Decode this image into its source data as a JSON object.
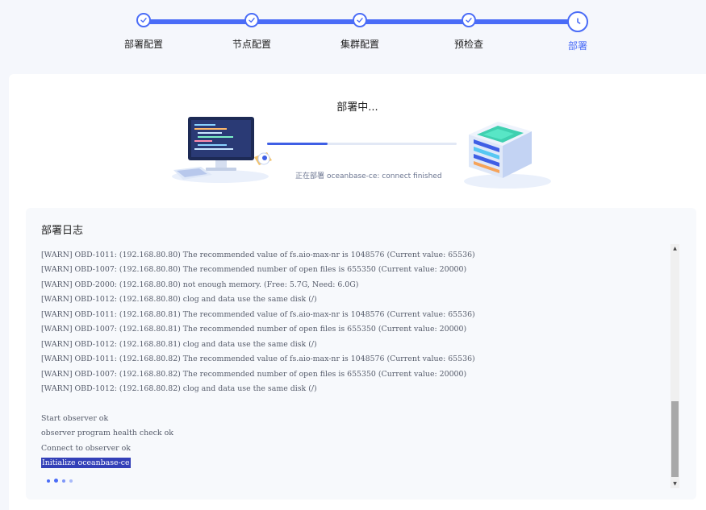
{
  "stepper": {
    "steps": [
      {
        "label": "部署配置",
        "state": "done"
      },
      {
        "label": "节点配置",
        "state": "done"
      },
      {
        "label": "集群配置",
        "state": "done"
      },
      {
        "label": "预检查",
        "state": "done"
      },
      {
        "label": "部署",
        "state": "current"
      }
    ],
    "done_icon": "check-icon",
    "current_icon": "clock-icon"
  },
  "deploy": {
    "title": "部署中...",
    "status_label": "正在部署",
    "status_text": "oceanbase-ce: connect finished",
    "progress": 0.32
  },
  "log": {
    "title": "部署日志",
    "lines": [
      "[WARN] OBD-1011: (192.168.80.80) The recommended value of fs.aio-max-nr is 1048576 (Current value: 65536)",
      "[WARN] OBD-1007: (192.168.80.80) The recommended number of open files is 655350 (Current value: 20000)",
      "[WARN] OBD-2000: (192.168.80.80) not enough memory. (Free: 5.7G, Need: 6.0G)",
      "[WARN] OBD-1012: (192.168.80.80) clog and data use the same disk (/)",
      "[WARN] OBD-1011: (192.168.80.81) The recommended value of fs.aio-max-nr is 1048576 (Current value: 65536)",
      "[WARN] OBD-1007: (192.168.80.81) The recommended number of open files is 655350 (Current value: 20000)",
      "[WARN] OBD-1012: (192.168.80.81) clog and data use the same disk (/)",
      "[WARN] OBD-1011: (192.168.80.82) The recommended value of fs.aio-max-nr is 1048576 (Current value: 65536)",
      "[WARN] OBD-1007: (192.168.80.82) The recommended number of open files is 655350 (Current value: 20000)",
      "[WARN] OBD-1012: (192.168.80.82) clog and data use the same disk (/)",
      "",
      "Start observer ok",
      "observer program health check ok",
      "Connect to observer ok"
    ],
    "highlighted_line": "Initialize oceanbase-ce"
  },
  "colors": {
    "accent": "#4a6cf7",
    "highlight_bg": "#3340b8"
  }
}
